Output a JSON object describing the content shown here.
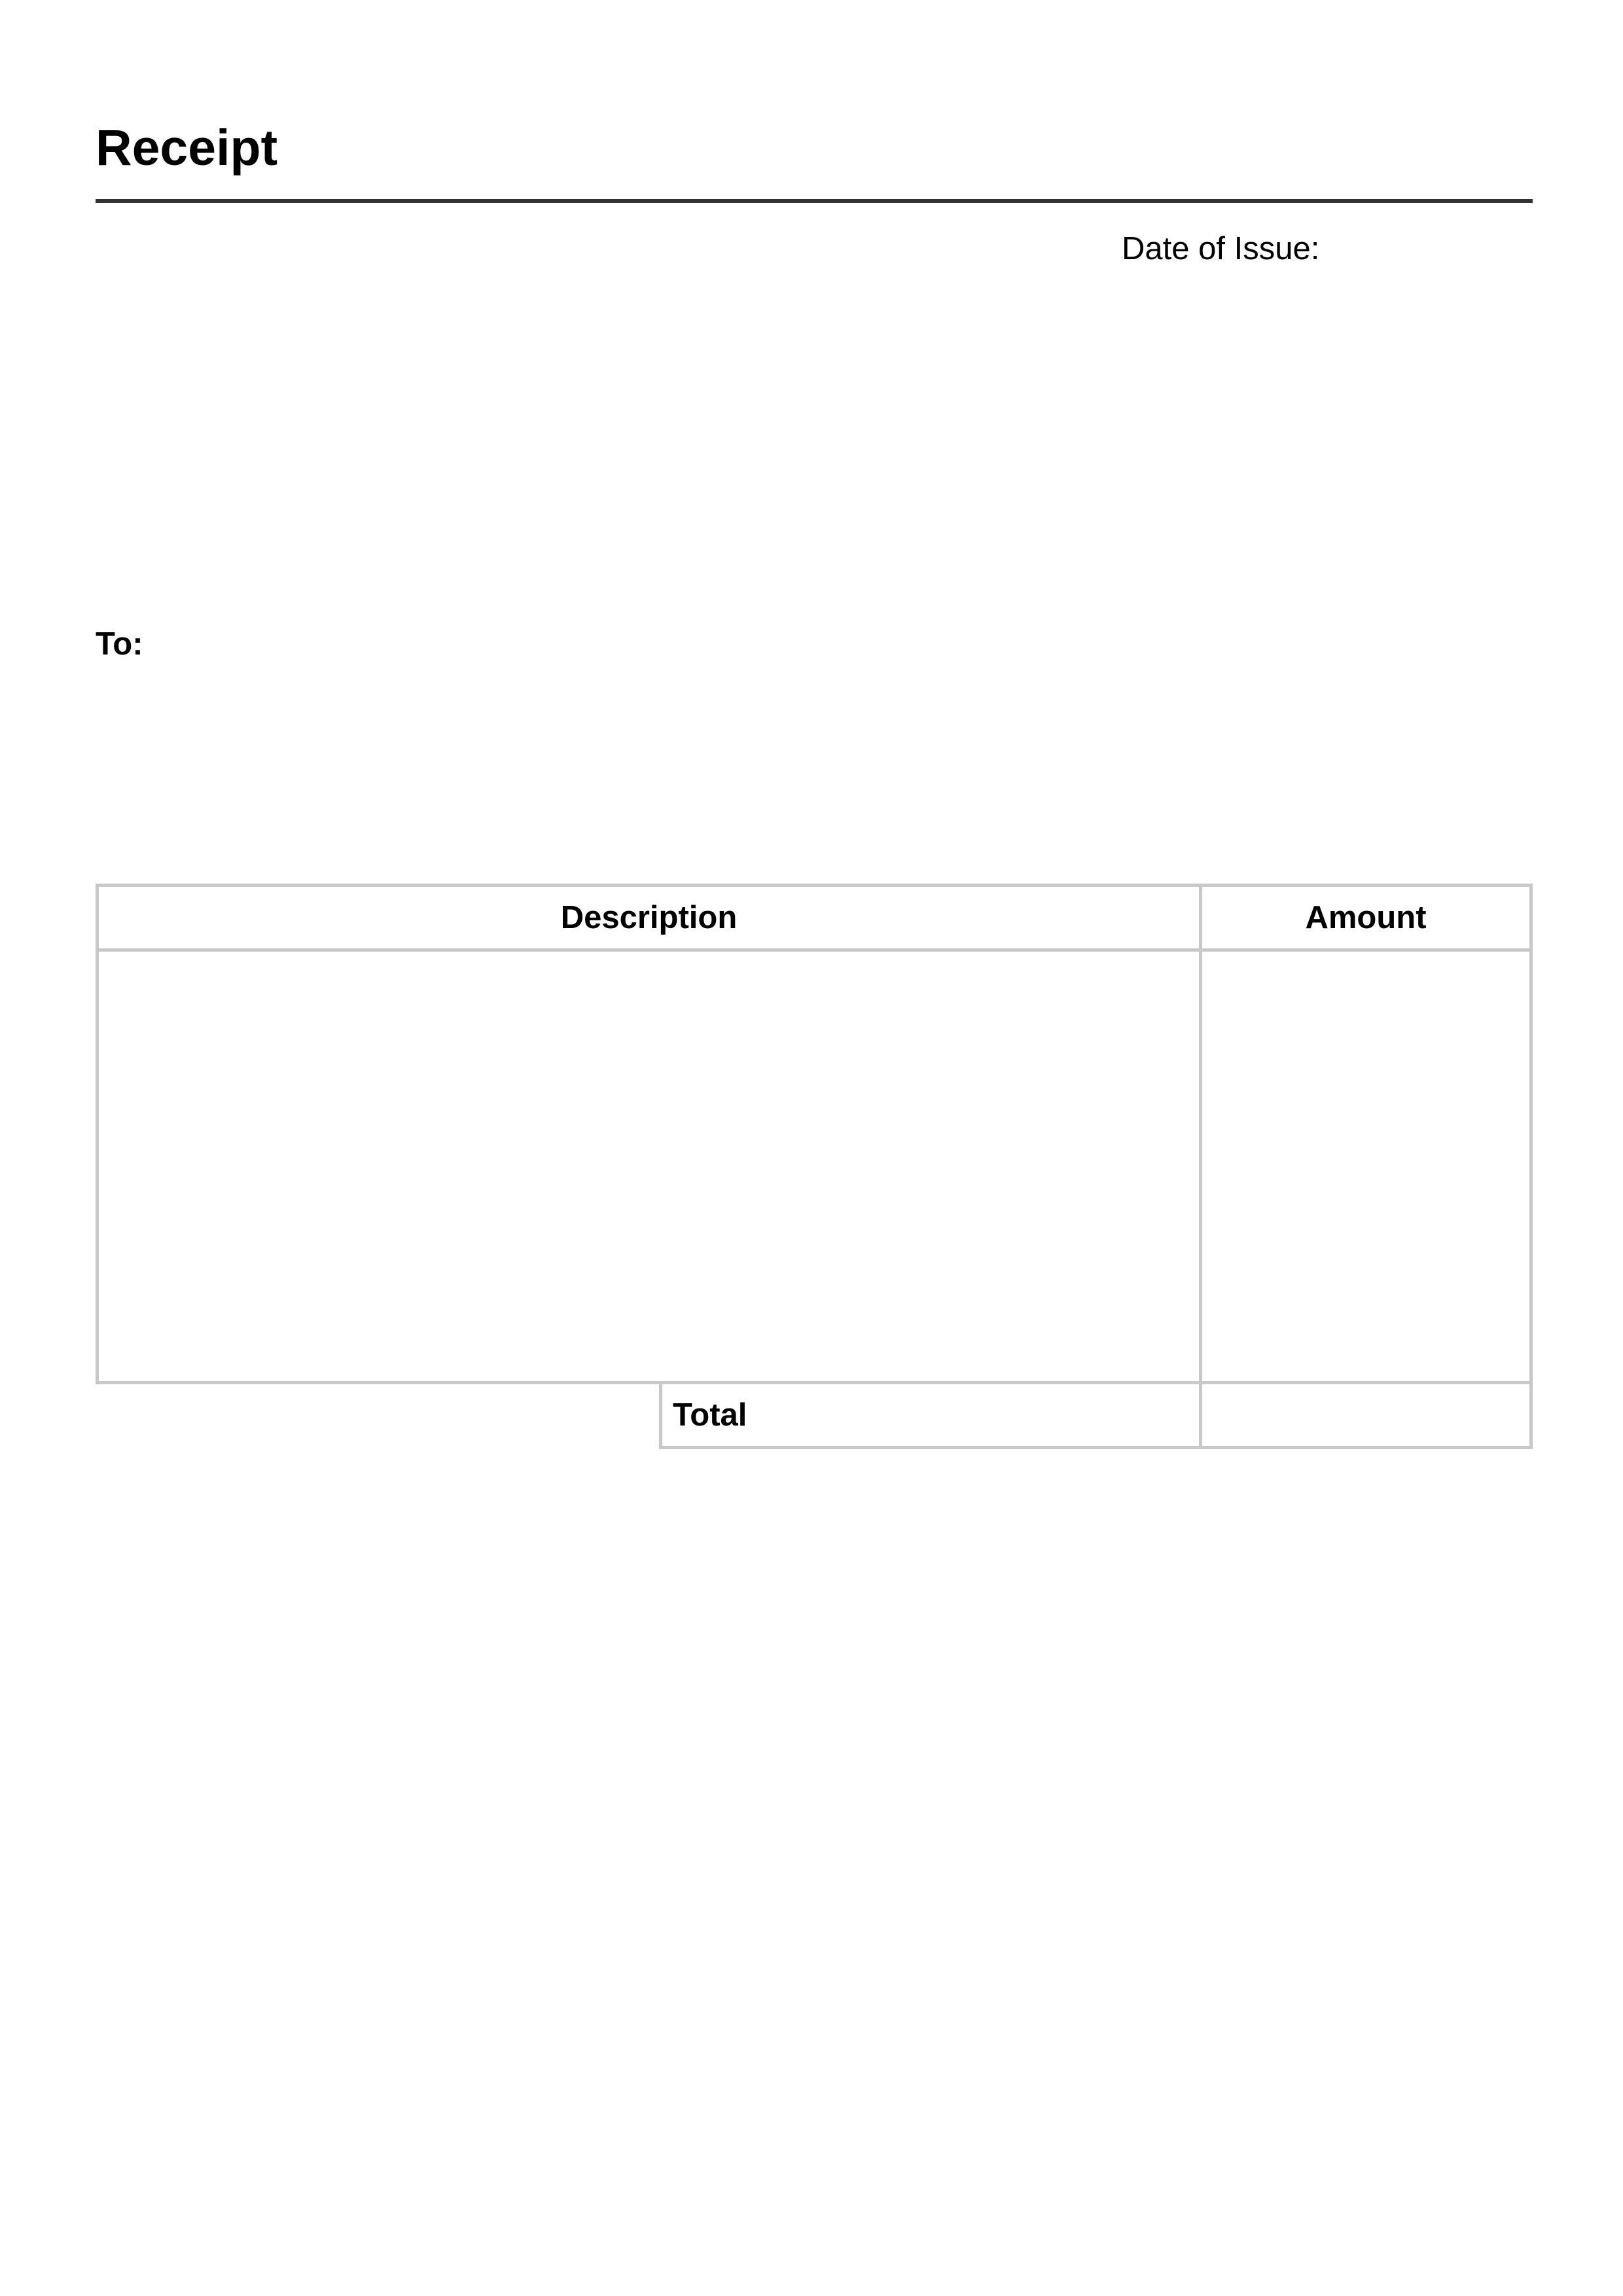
{
  "document": {
    "title": "Receipt",
    "date_label": "Date of Issue:",
    "to_label": "To:"
  },
  "table": {
    "headers": {
      "description": "Description",
      "amount": "Amount"
    },
    "rows": [
      {
        "description": "",
        "amount": ""
      }
    ],
    "total_label": "Total",
    "total_value": ""
  },
  "colors": {
    "title_rule": "#333333",
    "table_border": "#c8c8c8"
  }
}
